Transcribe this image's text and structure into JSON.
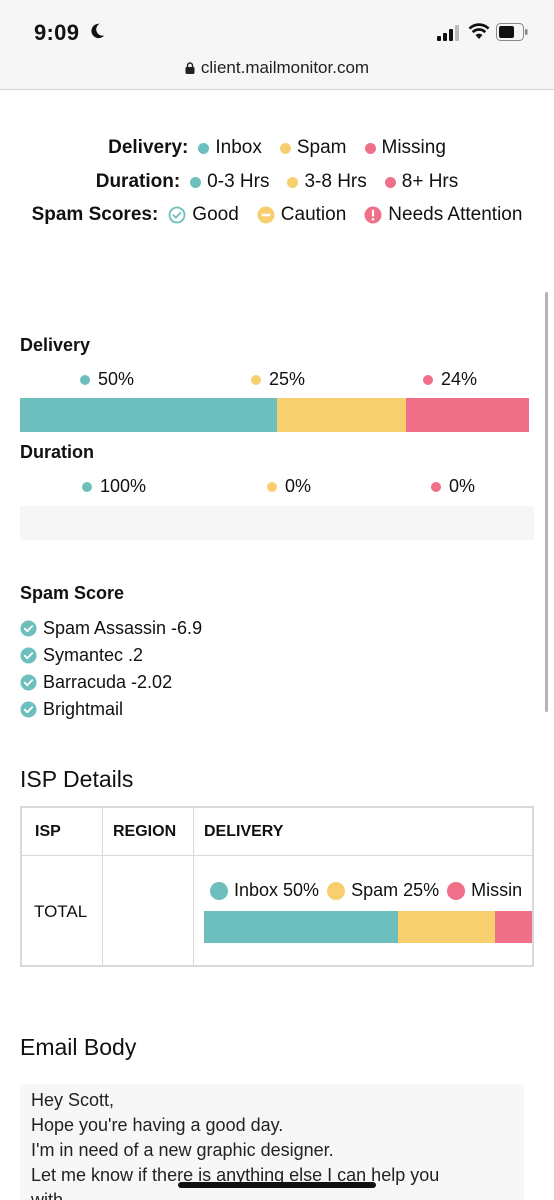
{
  "status_bar": {
    "time": "9:09",
    "url": "client.mailmonitor.com"
  },
  "legend": {
    "delivery": {
      "label": "Delivery:",
      "items": [
        {
          "label": "Inbox",
          "color": "#6cbfbd"
        },
        {
          "label": "Spam",
          "color": "#f7cf6f"
        },
        {
          "label": "Missing",
          "color": "#ef7088"
        }
      ]
    },
    "duration": {
      "label": "Duration:",
      "items": [
        {
          "label": "0-3 Hrs",
          "color": "#6cbfbd"
        },
        {
          "label": "3-8 Hrs",
          "color": "#f7cf6f"
        },
        {
          "label": "8+ Hrs",
          "color": "#ef7088"
        }
      ]
    },
    "spam_scores": {
      "label": "Spam Scores:",
      "items": [
        {
          "label": "Good",
          "icon": "check-circle-icon"
        },
        {
          "label": "Caution",
          "icon": "minus-circle-icon"
        },
        {
          "label": "Needs Attention",
          "icon": "exclamation-circle-icon"
        }
      ]
    }
  },
  "delivery": {
    "title": "Delivery",
    "values": [
      {
        "label": "50%",
        "percent": 50,
        "color": "#6cbfbd"
      },
      {
        "label": "25%",
        "percent": 25,
        "color": "#f7cf6f"
      },
      {
        "label": "24%",
        "percent": 24,
        "color": "#ef7088"
      }
    ]
  },
  "duration": {
    "title": "Duration",
    "values": [
      {
        "label": "100%",
        "color": "#6cbfbd"
      },
      {
        "label": "0%",
        "color": "#f7cf6f"
      },
      {
        "label": "0%",
        "color": "#ef7088"
      }
    ]
  },
  "spam_score": {
    "title": "Spam Score",
    "items": [
      "Spam Assassin -6.9",
      "Symantec .2",
      "Barracuda -2.02",
      "Brightmail"
    ]
  },
  "isp_details": {
    "title": "ISP Details",
    "headers": [
      "ISP",
      "REGION",
      "DELIVERY"
    ],
    "row": {
      "isp": "TOTAL",
      "legend": [
        {
          "label": "Inbox 50%",
          "color": "#6cbfbd"
        },
        {
          "label": "Spam 25%",
          "color": "#f7cf6f"
        },
        {
          "label": "Missin",
          "color": "#ef7088"
        }
      ],
      "bar": [
        57,
        28.5,
        14.5
      ]
    }
  },
  "email_body": {
    "title": "Email Body",
    "lines": [
      "Hey Scott,",
      "Hope you're having a good day.",
      "I'm in need of a new graphic designer.",
      "Let me know if there is anything else I can help you",
      "with."
    ]
  },
  "colors": {
    "teal": "#6cbfbd",
    "yellow": "#f7cf6f",
    "pink": "#ef7088"
  }
}
